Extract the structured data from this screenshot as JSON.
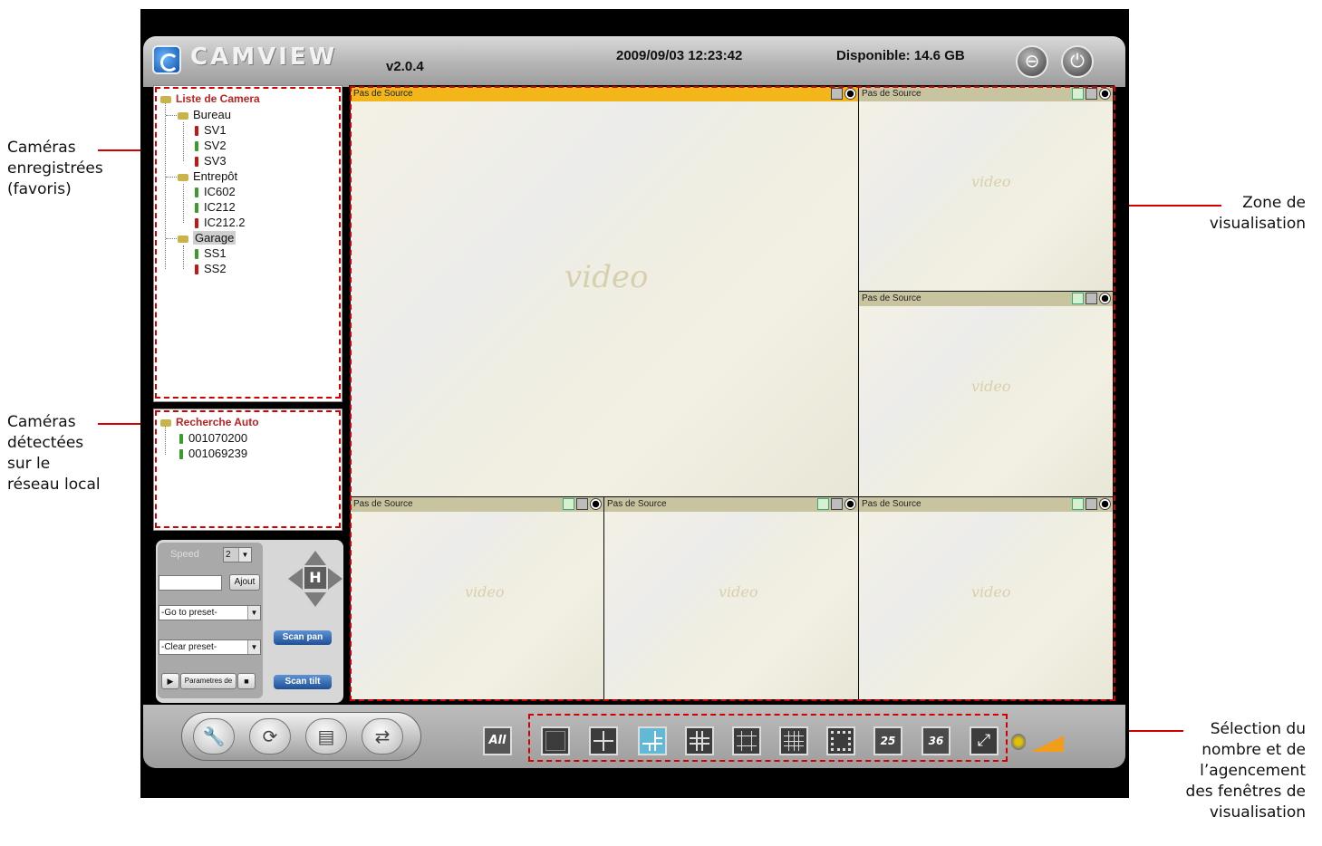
{
  "annotations": {
    "favorites": [
      "Caméras",
      "enregistrées",
      "(favoris)"
    ],
    "detected": [
      "Caméras",
      "détectées",
      "sur le",
      "réseau local"
    ],
    "view_zone": [
      "Zone de",
      "visualisation"
    ],
    "layout_selection": [
      "Sélection du",
      "nombre et de",
      "l’agencement",
      "des fenêtres de",
      "visualisation"
    ]
  },
  "app": {
    "logo": "CAMVIEW",
    "version": "v2.0.4",
    "datetime": "2009/09/03 12:23:42",
    "disk_free": "Disponible: 14.6 GB"
  },
  "camera_list": {
    "root": "Liste de Camera",
    "groups": [
      {
        "name": "Bureau",
        "cameras": [
          {
            "name": "SV1",
            "status": "red"
          },
          {
            "name": "SV2",
            "status": "green"
          },
          {
            "name": "SV3",
            "status": "red"
          }
        ]
      },
      {
        "name": "Entrepôt",
        "cameras": [
          {
            "name": "IC602",
            "status": "green"
          },
          {
            "name": "IC212",
            "status": "green"
          },
          {
            "name": "IC212.2",
            "status": "red"
          }
        ]
      },
      {
        "name": "Garage",
        "cameras": [
          {
            "name": "SS1",
            "status": "green"
          },
          {
            "name": "SS2",
            "status": "red"
          }
        ]
      }
    ]
  },
  "auto_search": {
    "root": "Recherche Auto",
    "devices": [
      {
        "name": "001070200"
      },
      {
        "name": "001069239"
      }
    ]
  },
  "ptz": {
    "speed_label": "Speed",
    "speed_value": "2",
    "add_button": "Ajout",
    "goto_preset": "-Go to preset-",
    "clear_preset": "-Clear preset-",
    "params_label": "Parametres de",
    "scan_pan": "Scan pan",
    "scan_tilt": "Scan tilt",
    "home": "H"
  },
  "viewer": {
    "source_label": "Pas de Source",
    "watermark": "video"
  },
  "layout_bar": {
    "all": "All",
    "n25": "25",
    "n36": "36"
  },
  "colors": {
    "annotation": "#d40000",
    "active_tile_bar": "#f2b61a",
    "tile_bar": "#c9c4a0",
    "selected_layout": "#62b9d6"
  }
}
